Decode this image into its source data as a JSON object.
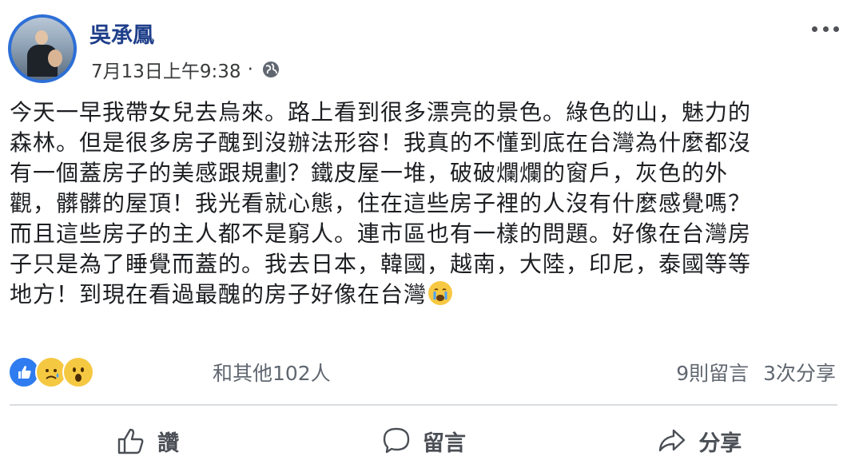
{
  "post": {
    "author": "吳承鳳",
    "timestamp": "7月13日上午9:38",
    "separator": "·",
    "audience_icon": "globe-icon",
    "text_lines": [
      "今天一早我帶女兒去烏來。路上看到很多漂亮的景色。綠色的山，魅力的",
      "森林。但是很多房子醜到沒辦法形容！我真的不懂到底在台灣為什麼都沒",
      "有一個蓋房子的美感跟規劃？鐵皮屋一堆，破破爛爛的窗戶，灰色的外",
      "觀，髒髒的屋頂！我光看就心態，住在這些房子裡的人沒有什麼感覺嗎？",
      "而且這些房子的主人都不是窮人。連市區也有一樣的問題。好像在台灣房",
      "子只是為了睡覺而蓋的。我去日本，韓國，越南，大陸，印尼，泰國等等",
      "地方！到現在看過最醜的房子好像在台灣"
    ]
  },
  "reactions": {
    "icons": [
      "like-reaction-icon",
      "sad-reaction-icon",
      "wow-reaction-icon"
    ],
    "count_text": "和其他102人"
  },
  "stats": {
    "comments": "9則留言",
    "shares": "3次分享"
  },
  "actions": {
    "like_label": "讚",
    "comment_label": "留言",
    "share_label": "分享"
  },
  "colors": {
    "author_name": "#1f3f8a",
    "like_blue": "#2f7cf0",
    "emoji_yellow": "#f5c842"
  }
}
